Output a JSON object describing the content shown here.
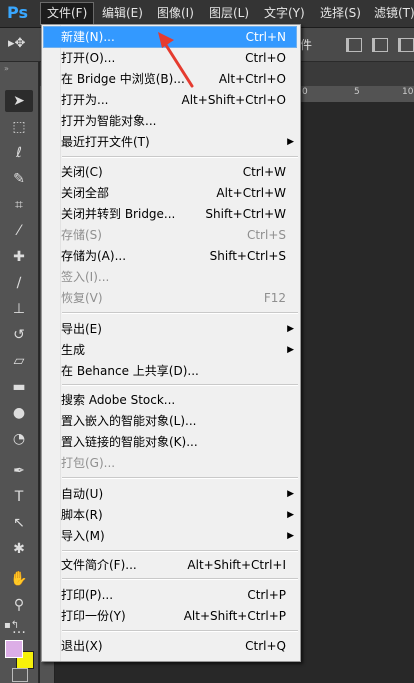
{
  "app": {
    "logo": "Ps"
  },
  "menubar": {
    "items": [
      {
        "label": "文件(F)",
        "active": true
      },
      {
        "label": "编辑(E)"
      },
      {
        "label": "图像(I)"
      },
      {
        "label": "图层(L)"
      },
      {
        "label": "文字(Y)"
      },
      {
        "label": "选择(S)"
      },
      {
        "label": "滤镜(T)"
      }
    ]
  },
  "options": {
    "partial_text": "件"
  },
  "rulers": {
    "h_labels": [
      "0",
      "5",
      "10"
    ]
  },
  "file_menu": {
    "items": [
      {
        "label": "新建(N)...",
        "shortcut": "Ctrl+N",
        "highlighted": true
      },
      {
        "label": "打开(O)...",
        "shortcut": "Ctrl+O"
      },
      {
        "label": "在 Bridge 中浏览(B)...",
        "shortcut": "Alt+Ctrl+O"
      },
      {
        "label": "打开为...",
        "shortcut": "Alt+Shift+Ctrl+O"
      },
      {
        "label": "打开为智能对象..."
      },
      {
        "label": "最近打开文件(T)",
        "submenu": true
      },
      {
        "label": "关闭(C)",
        "shortcut": "Ctrl+W"
      },
      {
        "label": "关闭全部",
        "shortcut": "Alt+Ctrl+W"
      },
      {
        "label": "关闭并转到 Bridge...",
        "shortcut": "Shift+Ctrl+W"
      },
      {
        "label": "存储(S)",
        "shortcut": "Ctrl+S",
        "disabled": true
      },
      {
        "label": "存储为(A)...",
        "shortcut": "Shift+Ctrl+S"
      },
      {
        "label": "签入(I)...",
        "disabled": true
      },
      {
        "label": "恢复(V)",
        "shortcut": "F12",
        "disabled": true
      },
      {
        "label": "导出(E)",
        "submenu": true
      },
      {
        "label": "生成",
        "submenu": true
      },
      {
        "label": "在 Behance 上共享(D)..."
      },
      {
        "label": "搜索 Adobe Stock..."
      },
      {
        "label": "置入嵌入的智能对象(L)..."
      },
      {
        "label": "置入链接的智能对象(K)..."
      },
      {
        "label": "打包(G)...",
        "disabled": true
      },
      {
        "label": "自动(U)",
        "submenu": true
      },
      {
        "label": "脚本(R)",
        "submenu": true
      },
      {
        "label": "导入(M)",
        "submenu": true
      },
      {
        "label": "文件简介(F)...",
        "shortcut": "Alt+Shift+Ctrl+I"
      },
      {
        "label": "打印(P)...",
        "shortcut": "Ctrl+P"
      },
      {
        "label": "打印一份(Y)",
        "shortcut": "Alt+Shift+Ctrl+P"
      },
      {
        "label": "退出(X)",
        "shortcut": "Ctrl+Q"
      }
    ]
  },
  "colors": {
    "foreground": "#dcaee6",
    "background": "#f7f20a",
    "highlight": "#3399ff",
    "annotation": "#e53b2f"
  }
}
